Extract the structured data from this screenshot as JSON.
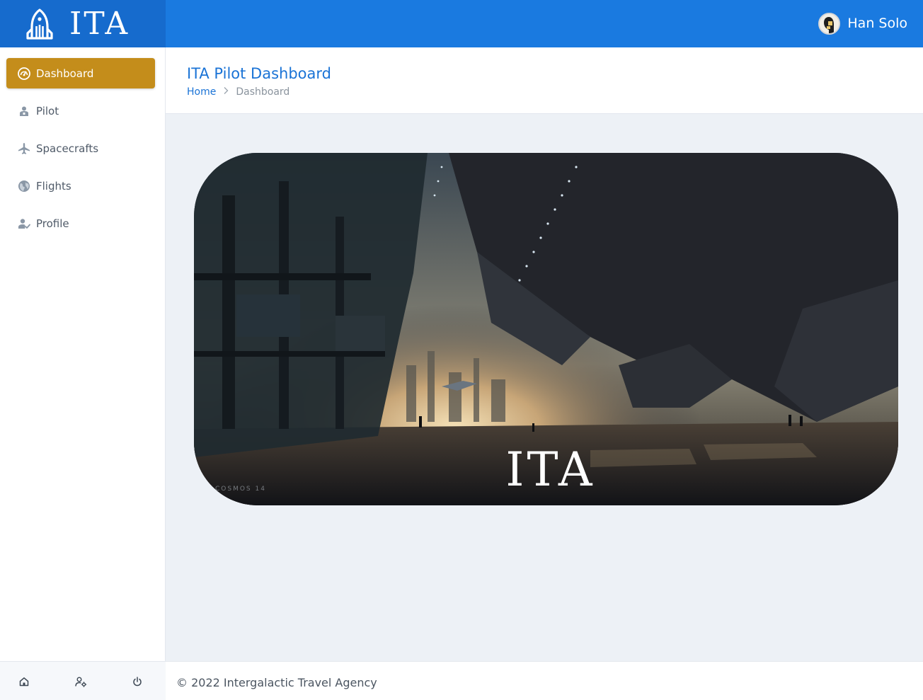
{
  "brand": {
    "name": "ITA",
    "logo_icon": "rocket-icon"
  },
  "user": {
    "name": "Han Solo",
    "avatar_icon": "avatar"
  },
  "sidebar": {
    "items": [
      {
        "label": "Dashboard",
        "icon": "dashboard-gauge-icon",
        "active": true
      },
      {
        "label": "Pilot",
        "icon": "pilot-icon",
        "active": false
      },
      {
        "label": "Spacecrafts",
        "icon": "airplane-icon",
        "active": false
      },
      {
        "label": "Flights",
        "icon": "globe-icon",
        "active": false
      },
      {
        "label": "Profile",
        "icon": "user-check-icon",
        "active": false
      }
    ],
    "footer_buttons": [
      "home-icon",
      "user-settings-icon",
      "power-icon"
    ]
  },
  "page": {
    "title": "ITA Pilot Dashboard",
    "breadcrumb": {
      "home": "Home",
      "current": "Dashboard"
    }
  },
  "hero": {
    "overlay_text": "ITA",
    "credit": "COSMOS 14"
  },
  "footer": {
    "text": "© 2022 Intergalactic Travel Agency"
  },
  "colors": {
    "topbar": "#1a7ae0",
    "brand_bg": "#166bcd",
    "active_item": "#c48d1b",
    "title": "#1a73d6",
    "content_bg": "#edf1f6"
  }
}
